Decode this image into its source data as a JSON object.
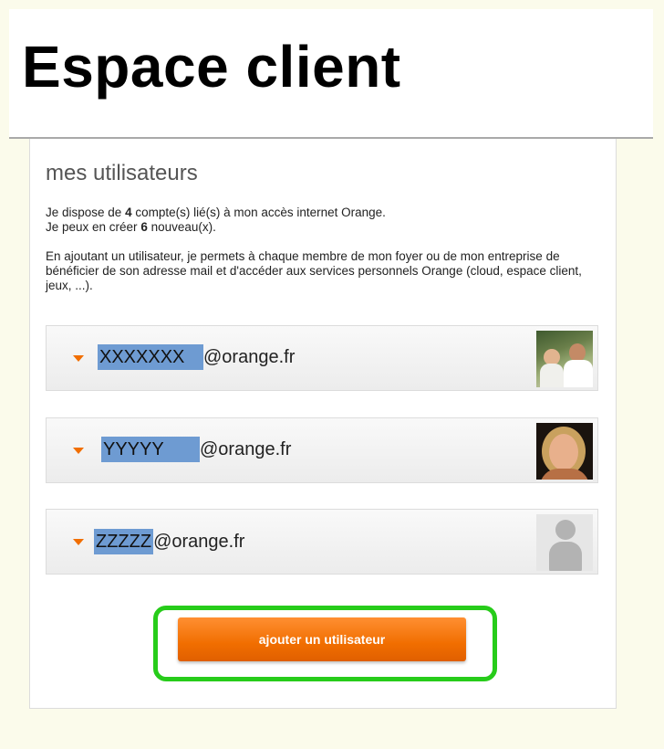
{
  "header": {
    "title": "Espace client"
  },
  "section": {
    "title": "mes utilisateurs",
    "info_line1_pre": "Je dispose de ",
    "info_line1_count": "4",
    "info_line1_post": " compte(s) lié(s) à mon accès internet Orange.",
    "info_line2_pre": "Je peux en créer ",
    "info_line2_count": "6",
    "info_line2_post": " nouveau(x).",
    "info_paragraph": "En ajoutant un utilisateur, je permets à chaque membre de mon foyer ou de mon entreprise de bénéficier de son adresse mail et d'accéder aux services personnels Orange (cloud, espace client, jeux, ...)."
  },
  "users": [
    {
      "masked": " XXXXXXX",
      "domain": "@orange.fr",
      "avatar": "photo-couple"
    },
    {
      "masked": " YYYYY",
      "domain": "@orange.fr",
      "avatar": "photo-woman"
    },
    {
      "masked": "ZZZZZ",
      "domain": "@orange.fr",
      "avatar": "generic-user-icon"
    }
  ],
  "actions": {
    "add_user_label": "ajouter un utilisateur"
  },
  "colors": {
    "accent": "#f16e00",
    "highlight": "#27cc1a",
    "mask": "#6e9bd2"
  }
}
